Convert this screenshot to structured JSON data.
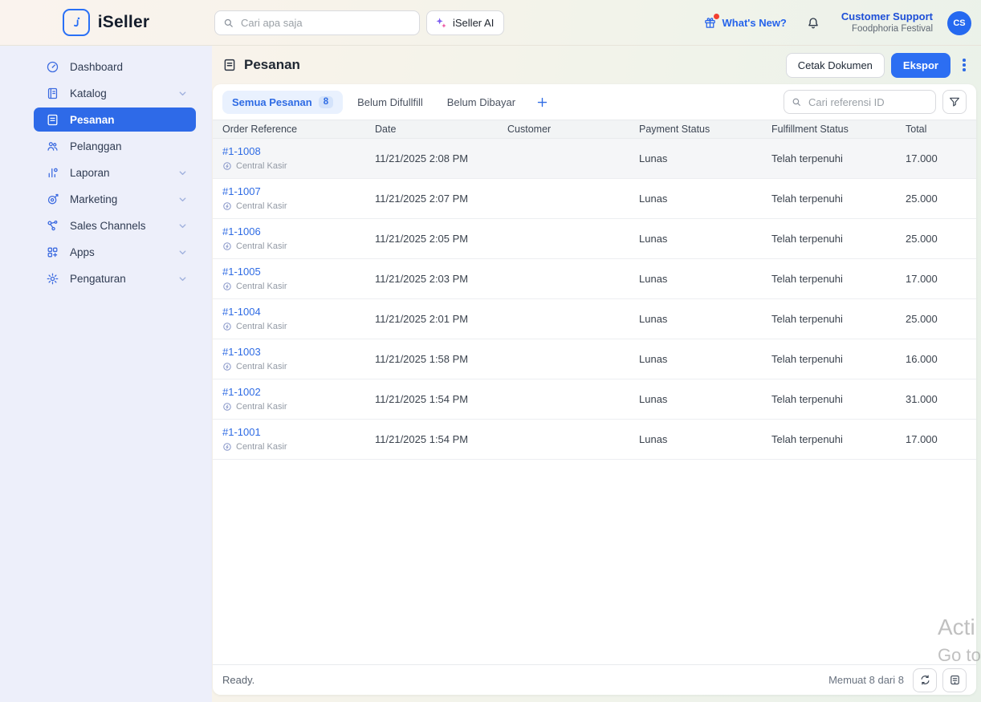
{
  "topbar": {
    "brand": "iSeller",
    "global_search_placeholder": "Cari apa saja",
    "ai_button_label": "iSeller AI",
    "whats_new_label": "What's New?",
    "account": {
      "name": "Customer Support",
      "store": "Foodphoria Festival",
      "avatar_initials": "CS"
    }
  },
  "sidebar": {
    "items": [
      {
        "label": "Dashboard",
        "icon": "dashboard-icon",
        "expandable": false,
        "active": false
      },
      {
        "label": "Katalog",
        "icon": "catalog-icon",
        "expandable": true,
        "active": false
      },
      {
        "label": "Pesanan",
        "icon": "orders-icon",
        "expandable": false,
        "active": true
      },
      {
        "label": "Pelanggan",
        "icon": "customers-icon",
        "expandable": false,
        "active": false
      },
      {
        "label": "Laporan",
        "icon": "reports-icon",
        "expandable": true,
        "active": false
      },
      {
        "label": "Marketing",
        "icon": "marketing-icon",
        "expandable": true,
        "active": false
      },
      {
        "label": "Sales Channels",
        "icon": "sales-channels-icon",
        "expandable": true,
        "active": false
      },
      {
        "label": "Apps",
        "icon": "apps-icon",
        "expandable": true,
        "active": false
      },
      {
        "label": "Pengaturan",
        "icon": "settings-icon",
        "expandable": true,
        "active": false
      }
    ]
  },
  "page": {
    "title": "Pesanan",
    "print_label": "Cetak Dokumen",
    "export_label": "Ekspor"
  },
  "tabs": [
    {
      "label": "Semua Pesanan",
      "badge": "8",
      "active": true
    },
    {
      "label": "Belum Difullfill",
      "badge": null,
      "active": false
    },
    {
      "label": "Belum Dibayar",
      "badge": null,
      "active": false
    }
  ],
  "list_search_placeholder": "Cari referensi ID",
  "table": {
    "columns": [
      "Order Reference",
      "Date",
      "Customer",
      "Payment Status",
      "Fulfillment Status",
      "Total"
    ],
    "rows": [
      {
        "ref": "#1-1008",
        "channel": "Central Kasir",
        "date": "11/21/2025 2:08 PM",
        "customer": "",
        "payment": "Lunas",
        "fulfillment": "Telah terpenuhi",
        "total": "17.000",
        "highlighted": true
      },
      {
        "ref": "#1-1007",
        "channel": "Central Kasir",
        "date": "11/21/2025 2:07 PM",
        "customer": "",
        "payment": "Lunas",
        "fulfillment": "Telah terpenuhi",
        "total": "25.000",
        "highlighted": false
      },
      {
        "ref": "#1-1006",
        "channel": "Central Kasir",
        "date": "11/21/2025 2:05 PM",
        "customer": "",
        "payment": "Lunas",
        "fulfillment": "Telah terpenuhi",
        "total": "25.000",
        "highlighted": false
      },
      {
        "ref": "#1-1005",
        "channel": "Central Kasir",
        "date": "11/21/2025 2:03 PM",
        "customer": "",
        "payment": "Lunas",
        "fulfillment": "Telah terpenuhi",
        "total": "17.000",
        "highlighted": false
      },
      {
        "ref": "#1-1004",
        "channel": "Central Kasir",
        "date": "11/21/2025 2:01 PM",
        "customer": "",
        "payment": "Lunas",
        "fulfillment": "Telah terpenuhi",
        "total": "25.000",
        "highlighted": false
      },
      {
        "ref": "#1-1003",
        "channel": "Central Kasir",
        "date": "11/21/2025 1:58 PM",
        "customer": "",
        "payment": "Lunas",
        "fulfillment": "Telah terpenuhi",
        "total": "16.000",
        "highlighted": false
      },
      {
        "ref": "#1-1002",
        "channel": "Central Kasir",
        "date": "11/21/2025 1:54 PM",
        "customer": "",
        "payment": "Lunas",
        "fulfillment": "Telah terpenuhi",
        "total": "31.000",
        "highlighted": false
      },
      {
        "ref": "#1-1001",
        "channel": "Central Kasir",
        "date": "11/21/2025 1:54 PM",
        "customer": "",
        "payment": "Lunas",
        "fulfillment": "Telah terpenuhi",
        "total": "17.000",
        "highlighted": false
      }
    ]
  },
  "statusbar": {
    "left": "Ready.",
    "right": "Memuat 8 dari 8"
  },
  "watermark": {
    "line1": "Acti",
    "line2": "Go to"
  },
  "colors": {
    "primary": "#2e6be4",
    "export_button": "#2c6ef2",
    "sidebar_active": "#2e6ae8",
    "avatar": "#2569f0",
    "notification_dot": "#f23f30",
    "tab_active_bg": "#e9f1fe",
    "header_bg": "#f2f4f5",
    "sidebar_bg": "#edeffa"
  }
}
